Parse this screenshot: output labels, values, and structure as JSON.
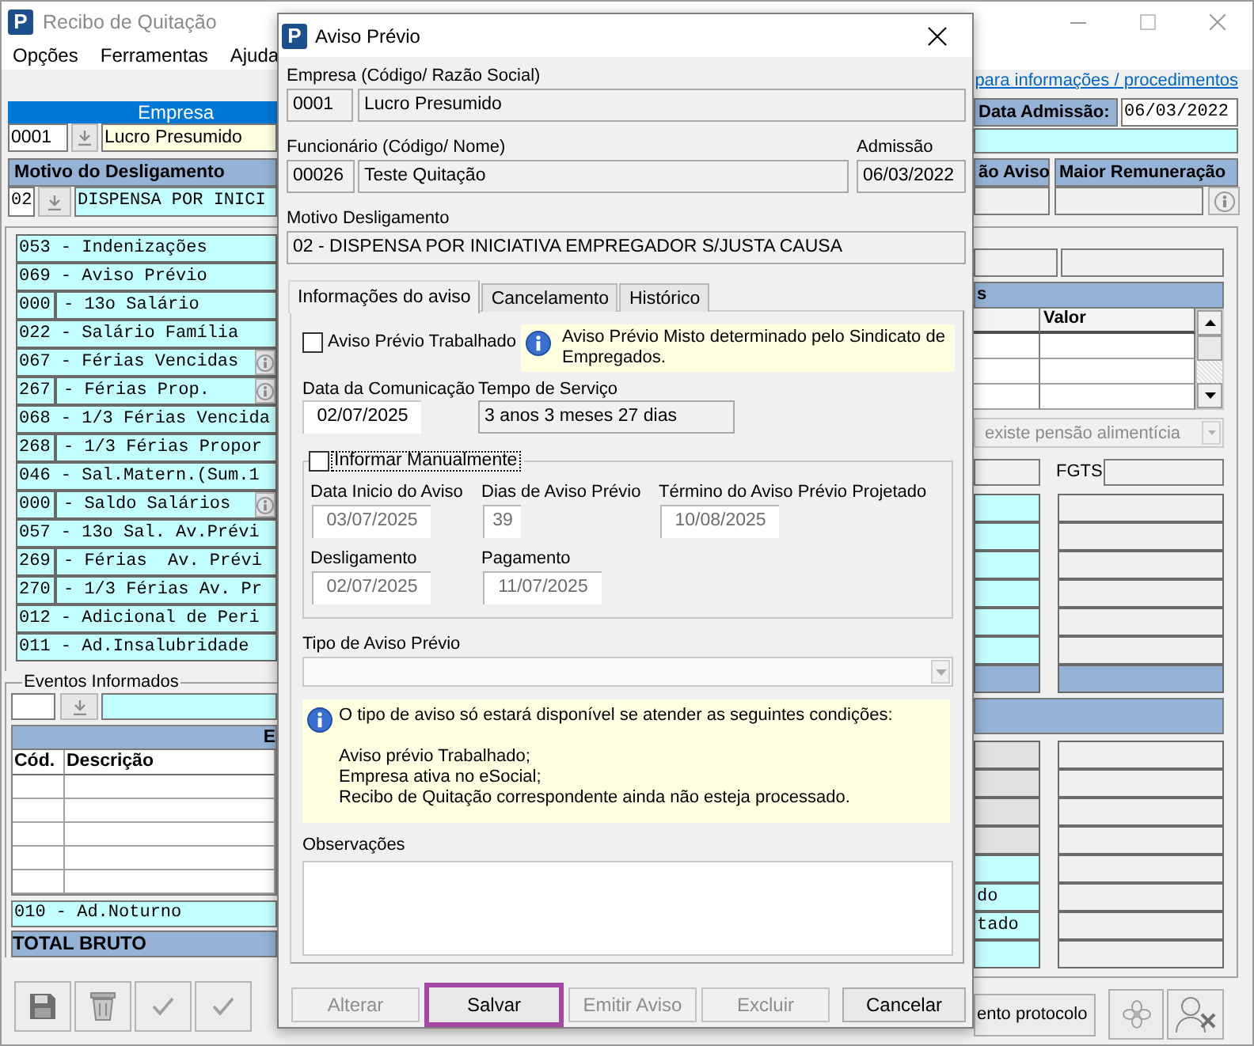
{
  "window": {
    "logo": "P",
    "title": "Recibo de Quitação",
    "menu": [
      "Opções",
      "Ferramentas",
      "Ajuda"
    ],
    "help_link": "para informações / procedimentos"
  },
  "empresa": {
    "header": "Empresa",
    "code": "0001",
    "name": "Lucro Presumido"
  },
  "admissao": {
    "label": "Data Admissão:",
    "value": "06/03/2022"
  },
  "motivo": {
    "header": "Motivo do Desligamento",
    "code": "02",
    "description": "DISPENSA POR INICI"
  },
  "aviso_headers": [
    "ão Aviso",
    "Maior Remuneração"
  ],
  "events": [
    {
      "kind": "joined",
      "text": "053 - Indenizações",
      "info": false
    },
    {
      "kind": "joined",
      "text": "069 - Aviso Prévio",
      "info": false
    },
    {
      "kind": "split",
      "code": "000",
      "text": "- 13o Salário",
      "info": false
    },
    {
      "kind": "joined",
      "text": "022 - Salário Família",
      "info": false
    },
    {
      "kind": "joined",
      "text": "067 - Férias Vencidas",
      "info": true
    },
    {
      "kind": "split",
      "code": "267",
      "text": "- Férias Prop.",
      "info": true
    },
    {
      "kind": "joined",
      "text": "068 - 1/3 Férias Vencida",
      "info": false
    },
    {
      "kind": "split",
      "code": "268",
      "text": "- 1/3 Férias Propor",
      "info": false
    },
    {
      "kind": "joined",
      "text": "046 - Sal.Matern.(Sum.1",
      "info": false
    },
    {
      "kind": "split",
      "code": "000",
      "text": "- Saldo Salários",
      "info": true
    },
    {
      "kind": "joined",
      "text": "057 - 13o Sal. Av.Prévi",
      "info": false
    },
    {
      "kind": "split",
      "code": "269",
      "text": "- Férias  Av. Prévi",
      "info": false
    },
    {
      "kind": "split",
      "code": "270",
      "text": "- 1/3 Férias Av. Pr",
      "info": false
    },
    {
      "kind": "joined",
      "text": "012 - Adicional de Peri",
      "info": false
    },
    {
      "kind": "joined",
      "text": "011 - Ad.Insalubridade",
      "info": false
    }
  ],
  "eventos_informados": {
    "legend": "Eventos Informados",
    "header": "E",
    "columns": [
      "Cód.",
      "Descrição"
    ]
  },
  "extra_event": "010 - Ad.Noturno",
  "total_label": "TOTAL BRUTO",
  "right_panel": {
    "grid_title": "s",
    "grid_column_2": "Valor",
    "pensao": {
      "value": "existe pensão alimentícia",
      "disabled": true
    },
    "fgts_label": "FGTS",
    "upper_rows": [
      {
        "kind": "value"
      },
      {
        "kind": "value"
      },
      {
        "kind": "value"
      },
      {
        "kind": "value"
      },
      {
        "kind": "value"
      },
      {
        "kind": "value"
      },
      {
        "kind": "total"
      }
    ],
    "lower_rows": [
      {
        "kind": "muted"
      },
      {
        "kind": "muted"
      },
      {
        "kind": "muted"
      },
      {
        "kind": "muted"
      },
      {
        "kind": "value"
      },
      {
        "kind": "value",
        "text": "do"
      },
      {
        "kind": "value",
        "text": "tado"
      },
      {
        "kind": "value"
      }
    ],
    "protocol_button": "ento protocolo"
  },
  "dialog": {
    "logo": "P",
    "title": "Aviso Prévio",
    "empresa": {
      "label": "Empresa (Código/ Razão Social)",
      "code": "0001",
      "name": "Lucro Presumido"
    },
    "funcionario": {
      "label": "Funcionário (Código/ Nome)",
      "code": "00026",
      "name": "Teste Quitação"
    },
    "admissao": {
      "label": "Admissão",
      "value": "06/03/2022"
    },
    "motivo": {
      "label": "Motivo Desligamento",
      "value": "02 - DISPENSA POR INICIATIVA EMPREGADOR S/JUSTA CAUSA"
    },
    "tabs": [
      {
        "label": "Informações do aviso",
        "selected": true
      },
      {
        "label": "Cancelamento",
        "selected": false
      },
      {
        "label": "Histórico",
        "selected": false
      }
    ],
    "aviso_trabalhado": {
      "label": "Aviso Prévio Trabalhado",
      "checked": false
    },
    "misto_note": "Aviso Prévio Misto determinado pelo Sindicato de Empregados.",
    "data_comunicacao": {
      "label": "Data da Comunicação",
      "value": "02/07/2025",
      "disabled": false
    },
    "tempo_servico": {
      "label": "Tempo de Serviço",
      "value": "3 anos 3 meses 27 dias"
    },
    "manual": {
      "label": "Informar Manualmente",
      "checked": false,
      "focused": true,
      "fields": [
        {
          "kind": "date",
          "label": "Data Inicio do Aviso",
          "value": "03/07/2025",
          "disabled": true
        },
        {
          "kind": "days",
          "label": "Dias de Aviso Prévio",
          "value": "39",
          "disabled": true
        },
        {
          "kind": "date",
          "label": "Término do Aviso Prévio Projetado",
          "value": "10/08/2025",
          "disabled": true
        },
        {
          "kind": "date",
          "label": "Desligamento",
          "value": "02/07/2025",
          "disabled": true
        },
        {
          "kind": "date",
          "label": "Pagamento",
          "value": "11/07/2025",
          "disabled": true
        }
      ]
    },
    "tipo_aviso": {
      "label": "Tipo de Aviso Prévio",
      "disabled": true
    },
    "conditions_note": {
      "intro": "O tipo de aviso só estará disponível se atender as seguintes condições:",
      "items": [
        "Aviso prévio Trabalhado;",
        "Empresa ativa no eSocial;",
        "Recibo de Quitação correspondente ainda não esteja processado."
      ]
    },
    "observacoes": {
      "label": "Observações"
    },
    "buttons": [
      {
        "label": "Alterar",
        "disabled": true,
        "highlighted": false
      },
      {
        "label": "Salvar",
        "disabled": false,
        "highlighted": true
      },
      {
        "label": "Emitir Aviso",
        "disabled": true,
        "highlighted": false
      },
      {
        "label": "Excluir",
        "disabled": true,
        "highlighted": false
      },
      {
        "label": "Cancelar",
        "disabled": false,
        "highlighted": false
      }
    ]
  }
}
